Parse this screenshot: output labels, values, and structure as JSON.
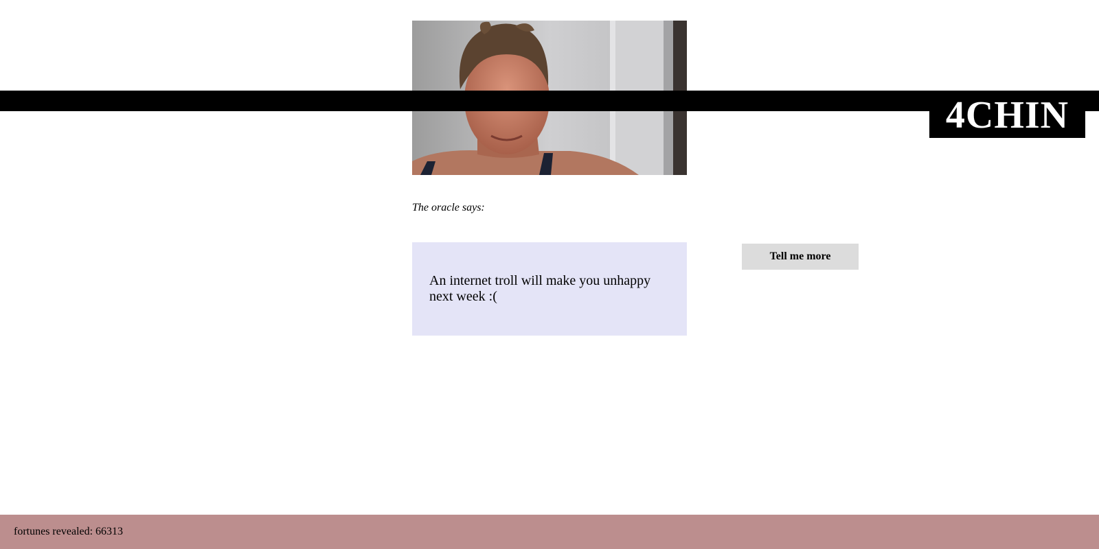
{
  "brand": {
    "logo_text": "4CHIN"
  },
  "photo": {
    "alt": "A photo of a woman looking down"
  },
  "oracle": {
    "label": "The oracle says:",
    "fortune": "An internet troll will make you unhappy next week :("
  },
  "actions": {
    "more_label": "Tell me more"
  },
  "footer": {
    "counter_label": "fortunes revealed: 66313"
  },
  "colors": {
    "header": "#000000",
    "fortune_bg": "#e4e4f7",
    "button_bg": "#dcdcdc",
    "footer_bg": "#bc8e8e"
  }
}
